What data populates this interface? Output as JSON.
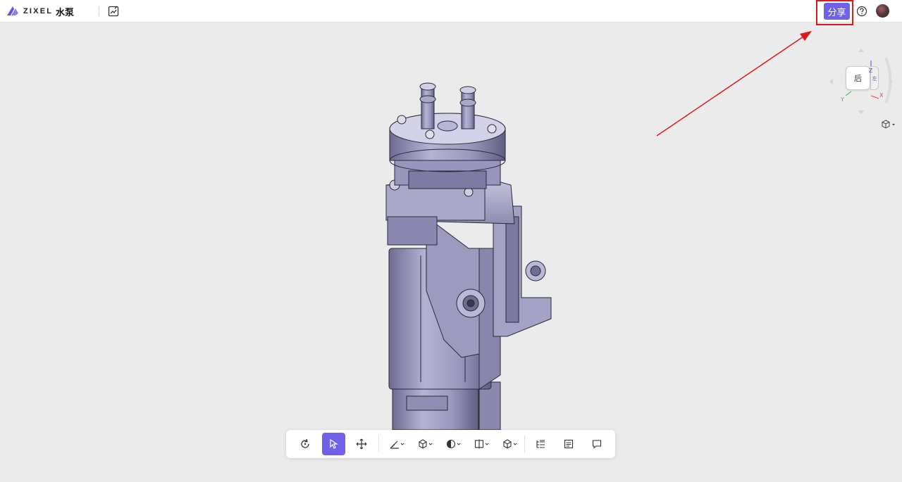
{
  "header": {
    "logo_text": "ZIXEL",
    "doc_title": "水泵",
    "share_label": "分享",
    "edit_icon": "edit-image-icon",
    "help_icon": "help-circle-icon",
    "avatar_icon": "user-avatar"
  },
  "viewcube": {
    "face_label": "后",
    "side_label": "左",
    "axis_x": "X",
    "axis_y": "Y",
    "axis_z": "Z"
  },
  "toolbar": {
    "items": [
      {
        "name": "rotate",
        "icon": "rotate-icon"
      },
      {
        "name": "select",
        "icon": "cursor-icon",
        "active": true
      },
      {
        "name": "pan",
        "icon": "move-icon"
      },
      {
        "name": "measure",
        "icon": "measure-icon",
        "dropdown": true
      },
      {
        "name": "explode",
        "icon": "explode-icon",
        "dropdown": true
      },
      {
        "name": "render-mode",
        "icon": "render-icon",
        "dropdown": true
      },
      {
        "name": "section",
        "icon": "section-icon",
        "dropdown": true
      },
      {
        "name": "view",
        "icon": "cube-view-icon",
        "dropdown": true
      },
      {
        "name": "structure-tree",
        "icon": "tree-icon"
      },
      {
        "name": "properties",
        "icon": "list-icon"
      },
      {
        "name": "comments",
        "icon": "comment-icon"
      }
    ]
  },
  "colors": {
    "accent": "#7061e8",
    "highlight": "#e0181e",
    "background": "#ebebeb",
    "model": "#9e9cc0"
  }
}
